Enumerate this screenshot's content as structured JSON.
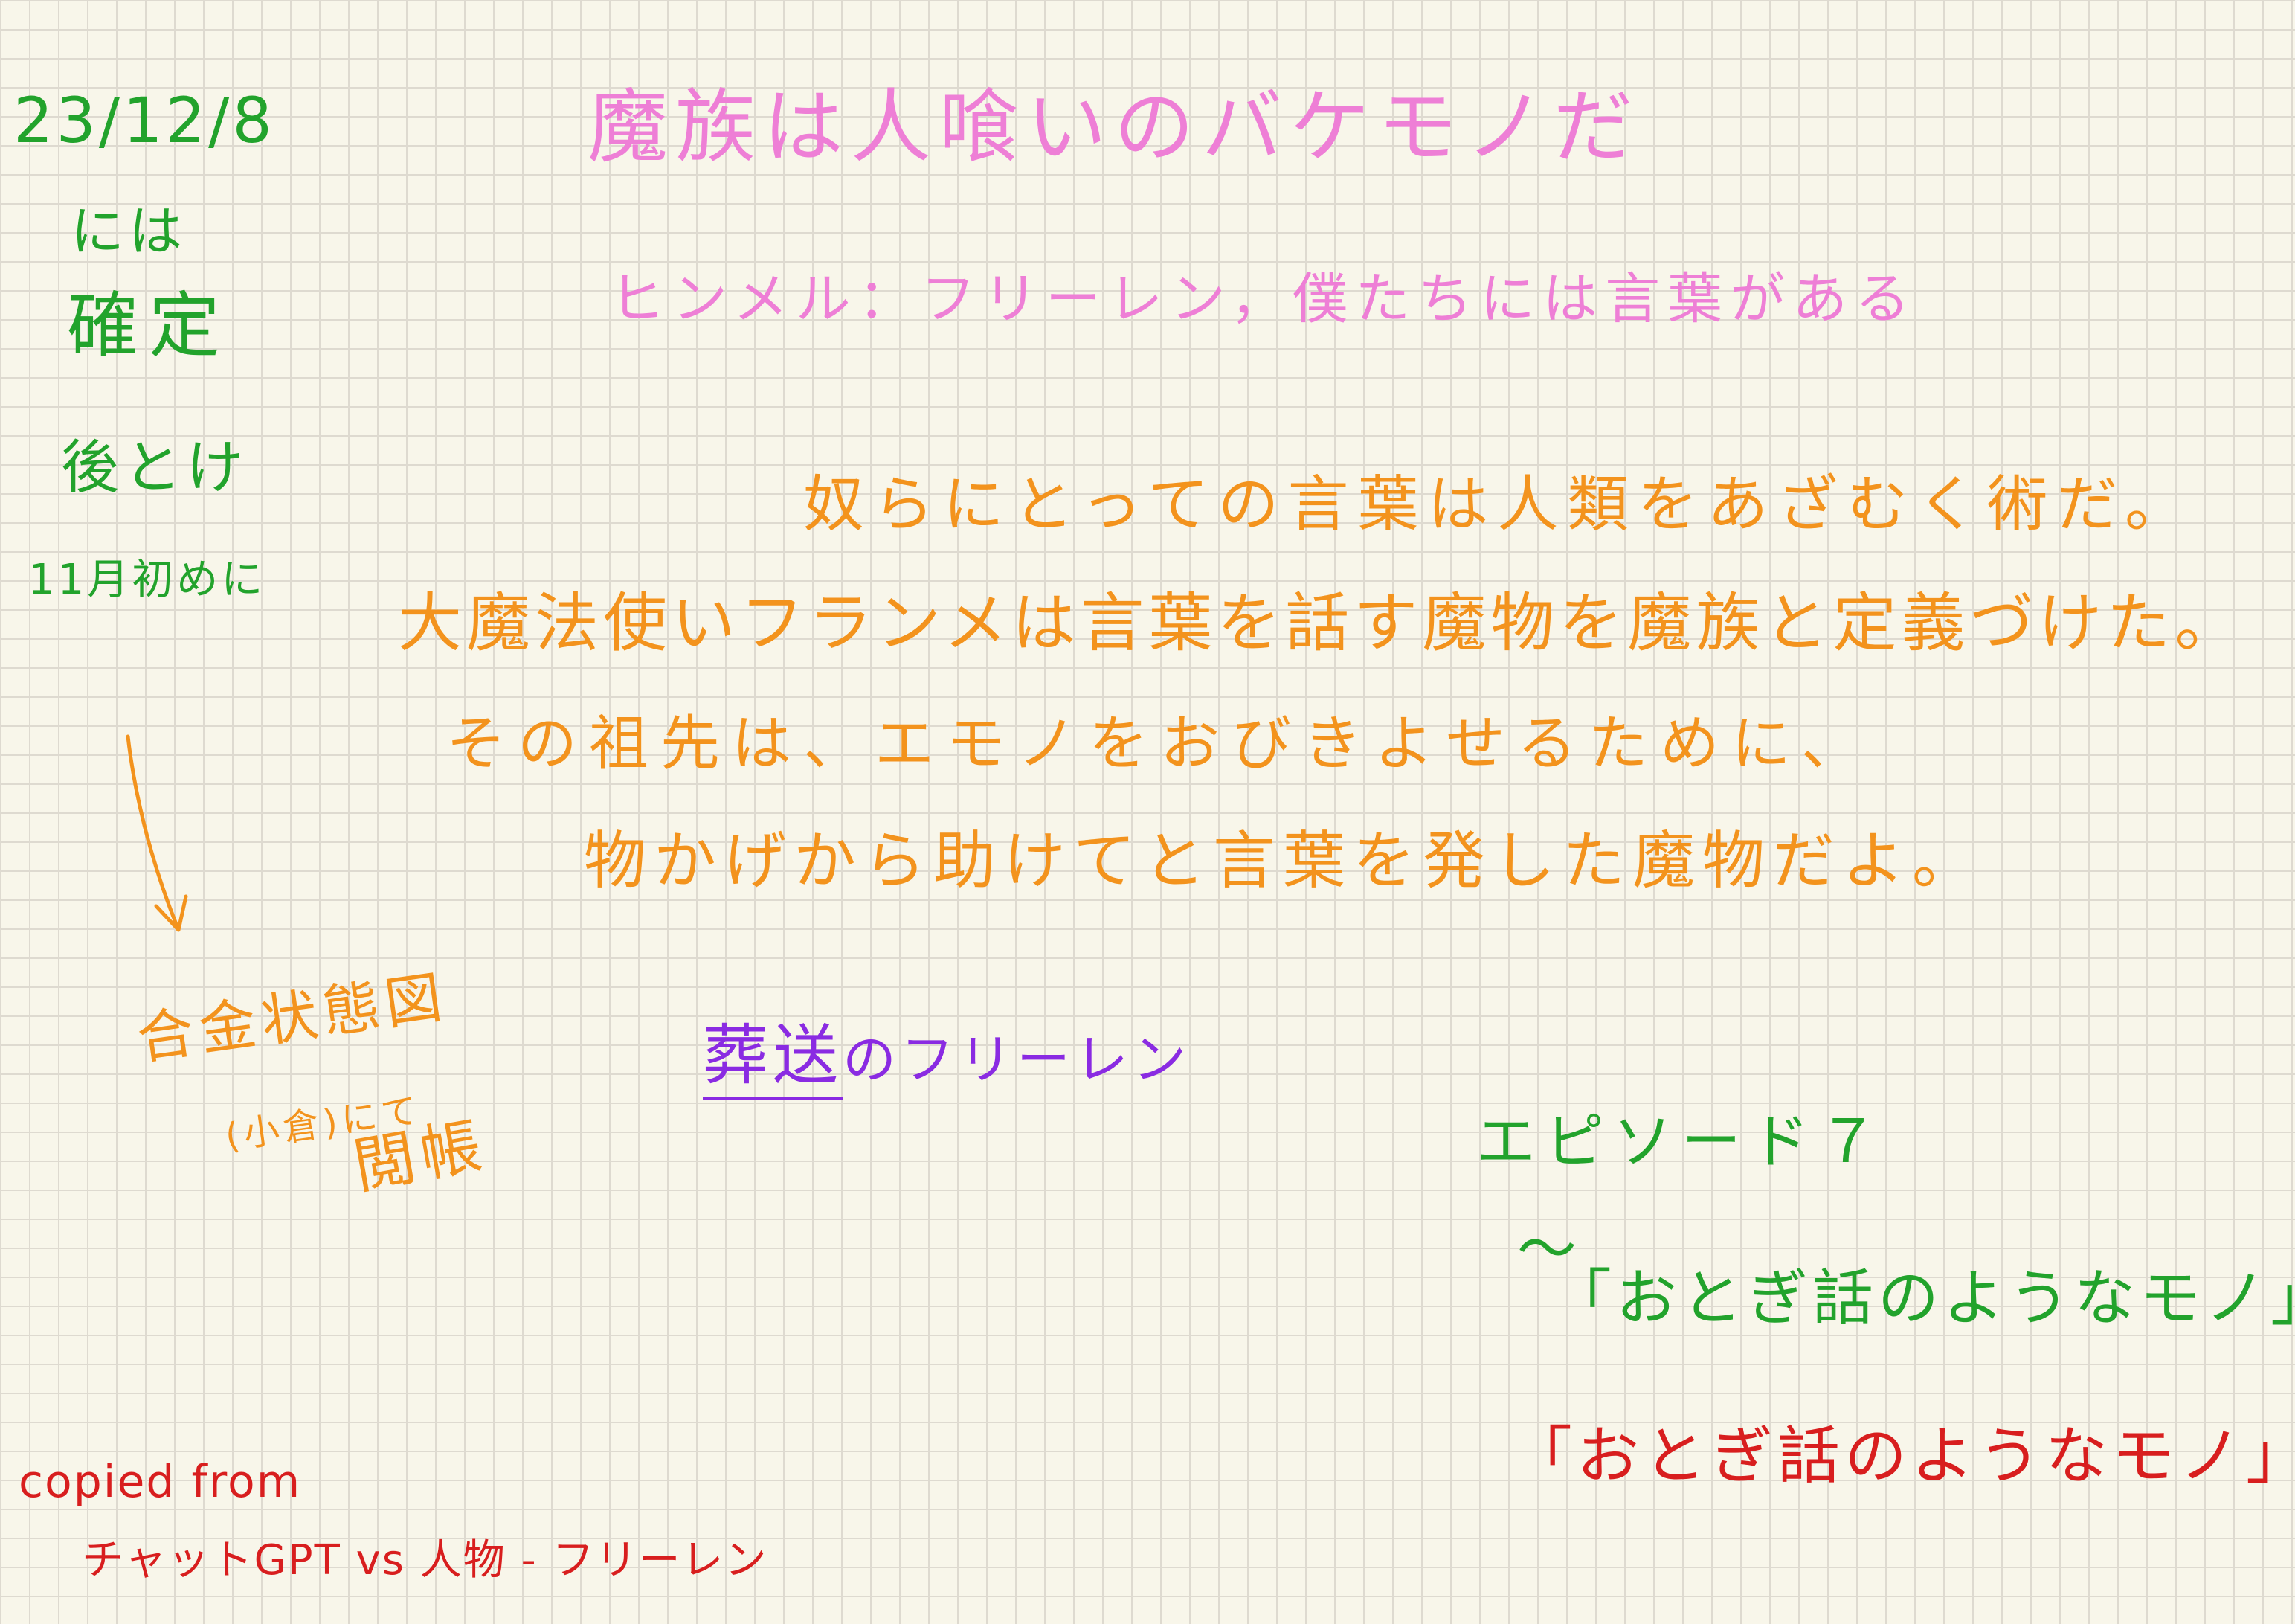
{
  "left_column": {
    "date": "23/12/8",
    "line1": "には",
    "line2": "確定",
    "line3": "後とけ",
    "line4": "11月初めに"
  },
  "header": {
    "title": "魔族は人喰いのバケモノだ",
    "subtitle": "ヒンメル：フリーレン，僕たちには言葉がある"
  },
  "main_text": {
    "line1": "奴らにとっての言葉は人類をあざむく術だ。",
    "line2": "大魔法使いフランメは言葉を話す魔物を魔族と定義づけた。",
    "line3": "その祖先は、エモノをおびきよせるために、",
    "line4": "物かげから助けてと言葉を発した魔物だよ。"
  },
  "side_note": {
    "line1": "合金状態図",
    "line2": "(小倉)にて",
    "line3": "閲帳"
  },
  "title_note": {
    "underlined": "葬送",
    "rest": "のフリーレン"
  },
  "episode": {
    "label": "エピソード７",
    "tilde": "〜",
    "green_title": "「おとぎ話のようなモノ」",
    "red_title": "「おとぎ話のようなモノ」"
  },
  "footer": {
    "line1": "copied from",
    "line2": "チャットGPT vs 人物 - フリーレン"
  },
  "colors": {
    "green": "#22a32c",
    "pink": "#ee7fd6",
    "orange": "#f3931d",
    "purple": "#8a2be2",
    "red": "#d81e1e",
    "paper": "#f8f6ea",
    "grid": "#dedad0"
  }
}
